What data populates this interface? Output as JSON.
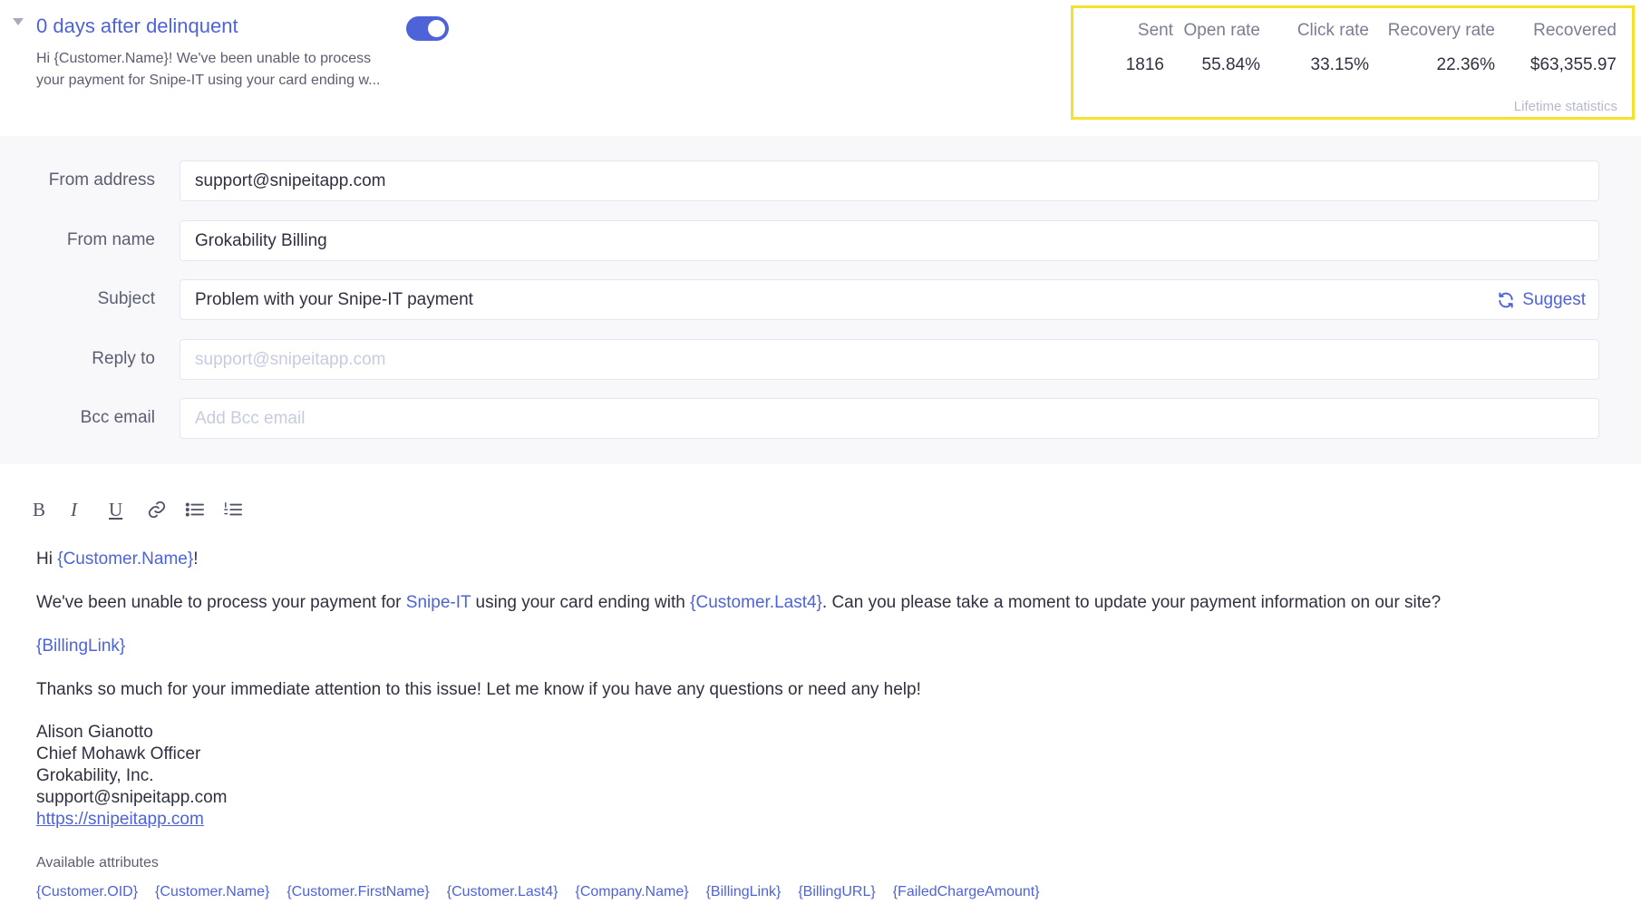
{
  "sequence": {
    "title": "0 days after delinquent",
    "preview": "Hi {Customer.Name}! We've been unable to process your payment for Snipe-IT using your card ending w...",
    "enabled": true,
    "accent_color": "#4e63d8"
  },
  "stats": {
    "items": [
      {
        "label": "Sent",
        "value": "1816"
      },
      {
        "label": "Open rate",
        "value": "55.84%"
      },
      {
        "label": "Click rate",
        "value": "33.15%"
      },
      {
        "label": "Recovery rate",
        "value": "22.36%"
      },
      {
        "label": "Recovered",
        "value": "$63,355.97"
      }
    ],
    "footer": "Lifetime statistics",
    "highlight_color": "#f3e12a"
  },
  "form": {
    "from_address": {
      "label": "From address",
      "value": "support@snipeitapp.com"
    },
    "from_name": {
      "label": "From name",
      "value": "Grokability Billing"
    },
    "subject": {
      "label": "Subject",
      "value": "Problem with your Snipe-IT payment",
      "suggest_label": "Suggest"
    },
    "reply_to": {
      "label": "Reply to",
      "placeholder": "support@snipeitapp.com"
    },
    "bcc": {
      "label": "Bcc email",
      "placeholder": "Add Bcc email"
    }
  },
  "toolbar": {
    "bold": "B",
    "italic": "I",
    "underline": "U",
    "link_icon": "link-icon",
    "bullet_list_icon": "bullet-list-icon",
    "numbered_list_icon": "numbered-list-icon"
  },
  "editor": {
    "greeting_prefix": "Hi ",
    "greeting_var": "{Customer.Name}",
    "greeting_suffix": "!",
    "p2_a": "We've been unable to process your payment for ",
    "p2_var1": "Snipe-IT",
    "p2_b": " using your card ending with ",
    "p2_var2": "{Customer.Last4}",
    "p2_c": ". Can you please take a moment to update your payment information on our site?",
    "billing_link": "{BillingLink}",
    "thanks": "Thanks so much for your immediate attention to this issue! Let me know if you have any questions or need any help!",
    "signature": {
      "name": "Alison Gianotto",
      "title": "Chief Mohawk Officer",
      "company": "Grokability, Inc.",
      "email": "support@snipeitapp.com",
      "url": "https://snipeitapp.com"
    }
  },
  "attributes": {
    "title": "Available attributes",
    "items": [
      "{Customer.OID}",
      "{Customer.Name}",
      "{Customer.FirstName}",
      "{Customer.Last4}",
      "{Company.Name}",
      "{BillingLink}",
      "{BillingURL}",
      "{FailedChargeAmount}"
    ]
  }
}
